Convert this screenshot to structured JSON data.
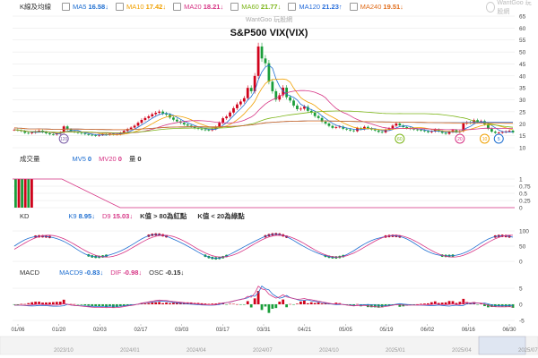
{
  "chart_data": {
    "type": "candlestick",
    "title": "S&P500 VIX(VIX)",
    "watermark": "WantGoo 玩股網",
    "price_panel": {
      "label": "K線及均線",
      "ma": [
        {
          "name": "MA5",
          "value": "16.58",
          "arrow": "↓",
          "color": "#1f6fd1"
        },
        {
          "name": "MA10",
          "value": "17.42",
          "arrow": "↓",
          "color": "#f0a000"
        },
        {
          "name": "MA20",
          "value": "18.21",
          "arrow": "↓",
          "color": "#d63384"
        },
        {
          "name": "MA60",
          "value": "21.77",
          "arrow": "↓",
          "color": "#7cb518"
        },
        {
          "name": "MA120",
          "value": "21.23",
          "arrow": "↑",
          "color": "#2a6fdb"
        },
        {
          "name": "MA240",
          "value": "19.51",
          "arrow": "↓",
          "color": "#e06d1c"
        }
      ],
      "y_ticks": [
        10,
        15,
        20,
        25,
        30,
        35,
        40,
        45,
        50,
        55,
        60,
        65
      ],
      "ylim": [
        10,
        65
      ],
      "series_closes": [
        17.5,
        17.2,
        16.9,
        16.2,
        16.0,
        16.3,
        16.8,
        17.1,
        16.5,
        16.0,
        15.6,
        15.5,
        15.8,
        16.4,
        18.9,
        17.6,
        16.9,
        16.5,
        16.2,
        15.9,
        15.6,
        15.4,
        15.2,
        15.0,
        15.3,
        15.6,
        15.4,
        15.8,
        15.5,
        15.6,
        16.2,
        17.0,
        17.8,
        18.4,
        19.2,
        20.4,
        21.6,
        22.4,
        23.1,
        24.0,
        24.6,
        25.1,
        24.3,
        23.8,
        22.6,
        21.7,
        21.0,
        20.4,
        19.7,
        19.2,
        18.8,
        18.2,
        17.9,
        17.6,
        17.4,
        17.3,
        17.8,
        18.7,
        20.4,
        22.3,
        23.0,
        24.7,
        26.5,
        28.1,
        29.3,
        30.7,
        35.0,
        33.6,
        40.0,
        52.3,
        47.3,
        45.3,
        37.6,
        33.6,
        30.1,
        31.9,
        35.1,
        31.1,
        29.7,
        27.6,
        26.1,
        26.3,
        27.1,
        25.4,
        24.6,
        23.2,
        22.4,
        20.9,
        20.1,
        19.1,
        18.3,
        18.6,
        18.8,
        17.9,
        17.6,
        17.2,
        16.9,
        18.2,
        17.8,
        18.7,
        18.1,
        17.6,
        17.2,
        16.6,
        16.4,
        17.5,
        18.1,
        19.2,
        20.1,
        19.3,
        18.6,
        18.2,
        17.9,
        17.6,
        17.4,
        17.2,
        16.9,
        16.5,
        16.8,
        17.6,
        16.8,
        16.2,
        15.8,
        16.6,
        17.3,
        16.5,
        16.9,
        20.1,
        20.6,
        20.4,
        21.5,
        20.7,
        21.1,
        19.8,
        17.9,
        16.7,
        16.2,
        16.3,
        16.5,
        16.8,
        17.1,
        16.4
      ],
      "markers": [
        "120",
        "60",
        "20",
        "10",
        "5"
      ]
    },
    "volume_panel": {
      "label": "成交量",
      "mv": [
        {
          "name": "MV5",
          "value": "0",
          "color": "#1f6fd1"
        },
        {
          "name": "MV20",
          "value": "0",
          "color": "#d63384"
        },
        {
          "name": "量",
          "value": "0",
          "color": "#333"
        }
      ],
      "y_ticks": [
        "1",
        "0.75",
        "0.5",
        "0.25",
        "0"
      ]
    },
    "kd_panel": {
      "label": "KD",
      "items": [
        {
          "name": "K9",
          "value": "8.95",
          "arrow": "↓",
          "color": "#1f6fd1"
        },
        {
          "name": "D9",
          "value": "15.03",
          "arrow": "↓",
          "color": "#d63384"
        }
      ],
      "notes": [
        "K值 > 80為紅點",
        "K值 < 20為綠點"
      ],
      "y_ticks": [
        "100",
        "50",
        "0"
      ]
    },
    "macd_panel": {
      "label": "MACD",
      "items": [
        {
          "name": "MACD9",
          "value": "-0.83",
          "arrow": "↓",
          "color": "#1f6fd1"
        },
        {
          "name": "DIF",
          "value": "-0.98",
          "arrow": "↓",
          "color": "#d63384"
        },
        {
          "name": "OSC",
          "value": "-0.15",
          "arrow": "↓",
          "color": "#333"
        }
      ],
      "y_ticks": [
        "5",
        "0",
        "-5"
      ]
    },
    "x_axis_dates": [
      "01/06",
      "01/20",
      "02/03",
      "02/17",
      "03/03",
      "03/17",
      "03/31",
      "04/21",
      "05/05",
      "05/19",
      "06/02",
      "06/16",
      "06/30"
    ],
    "navigator_dates": [
      "2023/10",
      "2024/01",
      "2024/04",
      "2024/07",
      "2024/10",
      "2025/01",
      "2025/04",
      "2025/07"
    ]
  },
  "colors": {
    "up": "#d0021b",
    "down": "#1a9e3a",
    "grid": "#e6e6e6"
  }
}
